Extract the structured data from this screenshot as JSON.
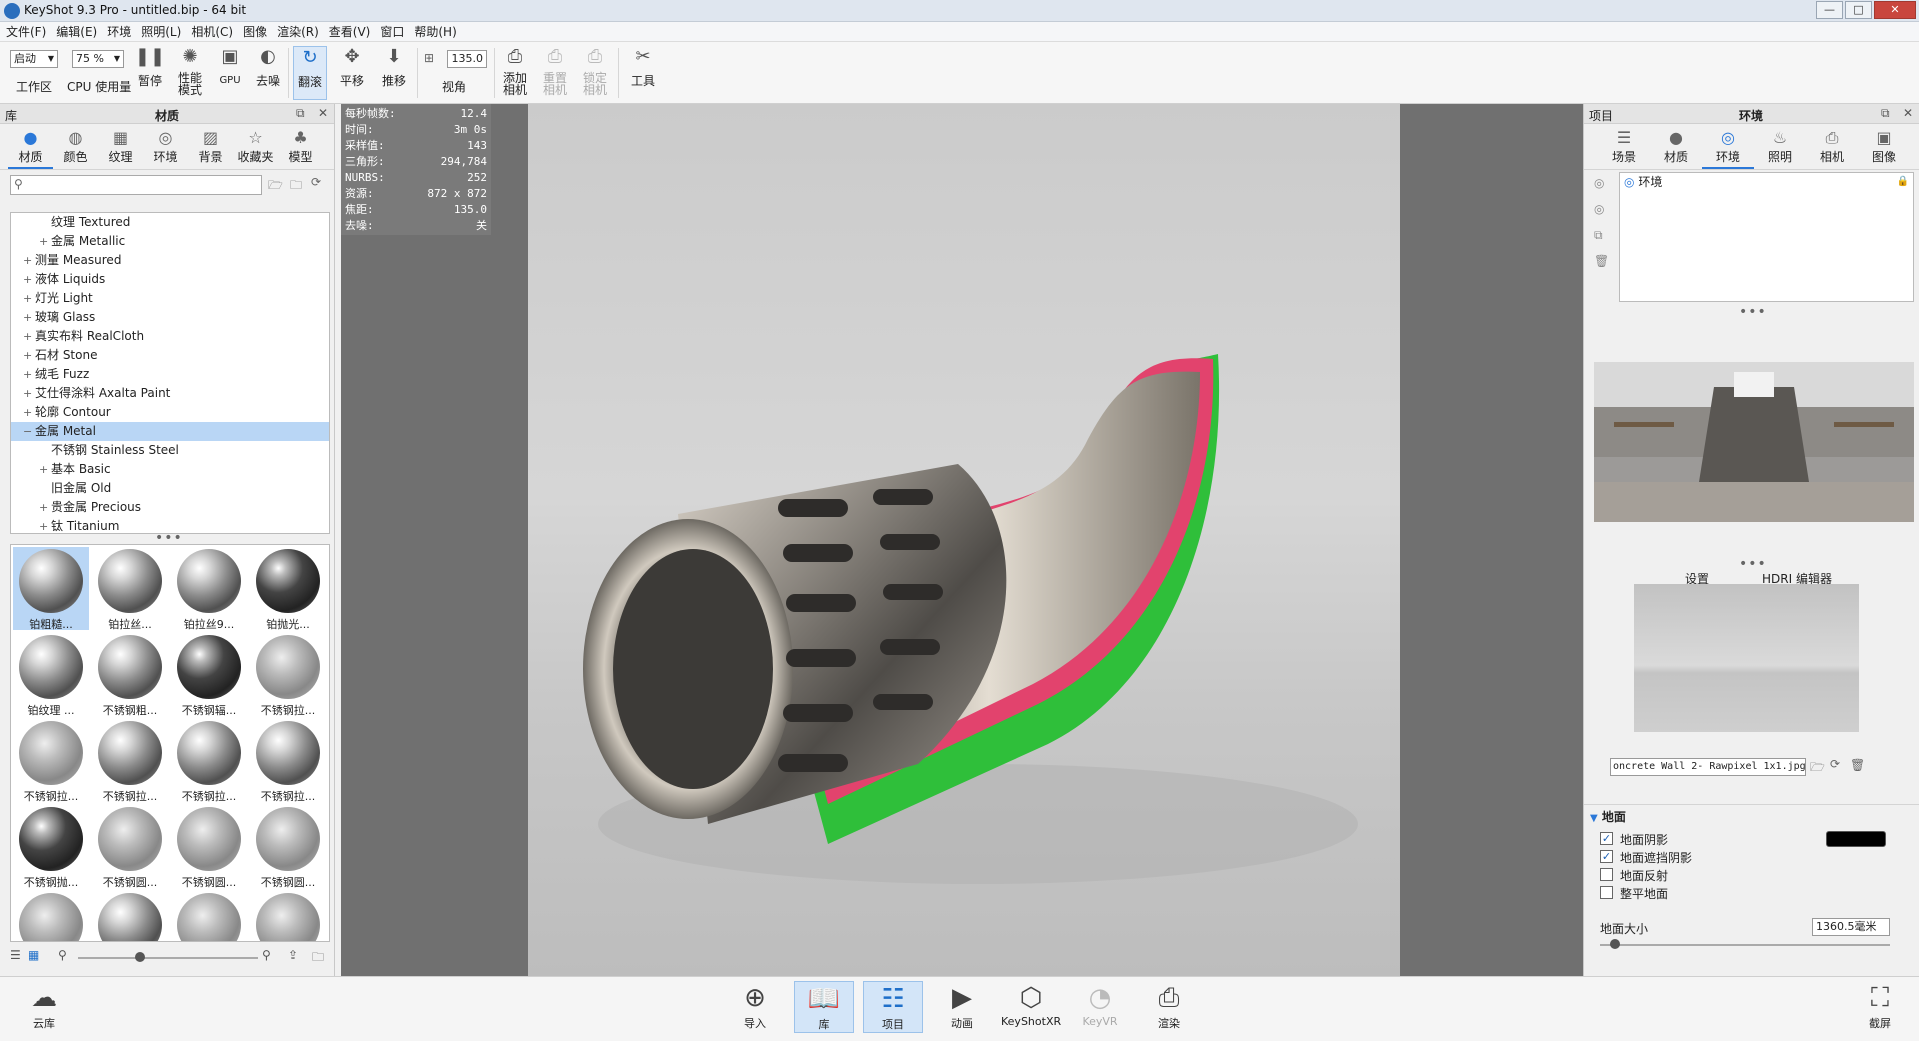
{
  "window": {
    "title": "KeyShot 9.3 Pro  - untitled.bip  - 64 bit",
    "min": "—",
    "max": "□",
    "close": "✕"
  },
  "menu": [
    "文件(F)",
    "编辑(E)",
    "环境",
    "照明(L)",
    "相机(C)",
    "图像",
    "渲染(R)",
    "查看(V)",
    "窗口",
    "帮助(H)"
  ],
  "toolbar": {
    "workspace_value": "启动",
    "workspace_label": "工作区",
    "cpu_value": "75 %",
    "cpu_label": "CPU 使用量",
    "pause": "暂停",
    "perf_mode": "性能\n模式",
    "gpu": "GPU",
    "denoise": "去噪",
    "tumble": "翻滚",
    "pan": "平移",
    "dolly": "推移",
    "fov_value": "135.0",
    "fov_label": "视角",
    "add_camera": "添加\n相机",
    "reset_camera": "重置\n相机",
    "lock_camera": "锁定\n相机",
    "tools": "工具"
  },
  "left": {
    "header_left": "库",
    "header_title": "材质",
    "tabs": [
      "材质",
      "颜色",
      "纹理",
      "环境",
      "背景",
      "收藏夹",
      "模型"
    ],
    "tree": [
      {
        "label": "纹理 Textured",
        "indent": 2,
        "tog": ""
      },
      {
        "label": "金属 Metallic",
        "indent": 2,
        "tog": "+"
      },
      {
        "label": "测量 Measured",
        "indent": 1,
        "tog": "+"
      },
      {
        "label": "液体 Liquids",
        "indent": 1,
        "tog": "+"
      },
      {
        "label": "灯光 Light",
        "indent": 1,
        "tog": "+"
      },
      {
        "label": "玻璃 Glass",
        "indent": 1,
        "tog": "+"
      },
      {
        "label": "真实布料 RealCloth",
        "indent": 1,
        "tog": "+"
      },
      {
        "label": "石材 Stone",
        "indent": 1,
        "tog": "+"
      },
      {
        "label": "绒毛 Fuzz",
        "indent": 1,
        "tog": "+"
      },
      {
        "label": "艾仕得涂料 Axalta Paint",
        "indent": 1,
        "tog": "+"
      },
      {
        "label": "轮廓 Contour",
        "indent": 1,
        "tog": "+"
      },
      {
        "label": "金属 Metal",
        "indent": 1,
        "tog": "−",
        "sel": true
      },
      {
        "label": "不锈钢 Stainless Steel",
        "indent": 2,
        "tog": ""
      },
      {
        "label": "基本 Basic",
        "indent": 2,
        "tog": "+"
      },
      {
        "label": "旧金属 Old",
        "indent": 2,
        "tog": ""
      },
      {
        "label": "贵金属 Precious",
        "indent": 2,
        "tog": "+"
      },
      {
        "label": "钛 Titanium",
        "indent": 2,
        "tog": "+"
      }
    ],
    "thumbs": [
      {
        "label": "铂粗糙...",
        "style": "",
        "sel": true
      },
      {
        "label": "铂拉丝...",
        "style": ""
      },
      {
        "label": "铂拉丝9...",
        "style": ""
      },
      {
        "label": "铂抛光...",
        "style": "dark"
      },
      {
        "label": "铂纹理 ...",
        "style": ""
      },
      {
        "label": "不锈钢粗...",
        "style": ""
      },
      {
        "label": "不锈钢辐...",
        "style": "dark"
      },
      {
        "label": "不锈钢拉...",
        "style": "pat"
      },
      {
        "label": "不锈钢拉...",
        "style": "pat"
      },
      {
        "label": "不锈钢拉...",
        "style": ""
      },
      {
        "label": "不锈钢拉...",
        "style": ""
      },
      {
        "label": "不锈钢拉...",
        "style": ""
      },
      {
        "label": "不锈钢抛...",
        "style": "dark"
      },
      {
        "label": "不锈钢圆...",
        "style": "pat"
      },
      {
        "label": "不锈钢圆...",
        "style": "pat"
      },
      {
        "label": "不锈钢圆...",
        "style": "pat"
      },
      {
        "label": "",
        "style": "pat"
      },
      {
        "label": "",
        "style": ""
      },
      {
        "label": "",
        "style": "pat"
      },
      {
        "label": "",
        "style": "pat"
      }
    ]
  },
  "stats": [
    {
      "k": "每秒帧数:",
      "v": "12.4"
    },
    {
      "k": "时间:",
      "v": "3m 0s"
    },
    {
      "k": "采样值:",
      "v": "143"
    },
    {
      "k": "三角形:",
      "v": "294,784"
    },
    {
      "k": "NURBS:",
      "v": "252"
    },
    {
      "k": "资源:",
      "v": "872 x 872"
    },
    {
      "k": "焦距:",
      "v": "135.0"
    },
    {
      "k": "去噪:",
      "v": "关"
    }
  ],
  "right": {
    "header_left": "项目",
    "header_title": "环境",
    "tabs": [
      "场景",
      "材质",
      "环境",
      "照明",
      "相机",
      "图像"
    ],
    "env_item": "环境",
    "subtabs": [
      "设置",
      "HDRI 编辑器"
    ],
    "env_file": "oncrete Wall 2- Rawpixel 1x1.jpg",
    "ground_section": "地面",
    "ground_options": [
      {
        "label": "地面阴影",
        "checked": true
      },
      {
        "label": "地面遮挡阴影",
        "checked": true
      },
      {
        "label": "地面反射",
        "checked": false
      },
      {
        "label": "整平地面",
        "checked": false
      }
    ],
    "ground_size_label": "地面大小",
    "ground_size_value": "1360.5毫米"
  },
  "bottom": {
    "cloud": "云库",
    "buttons": [
      {
        "label": "导入",
        "icon": "import-icon"
      },
      {
        "label": "库",
        "icon": "library-icon",
        "active": true
      },
      {
        "label": "项目",
        "icon": "project-icon",
        "active": true
      },
      {
        "label": "动画",
        "icon": "animation-icon"
      },
      {
        "label": "KeyShotXR",
        "icon": "keyshotxr-icon"
      },
      {
        "label": "KeyVR",
        "icon": "keyvr-icon",
        "dim": true
      },
      {
        "label": "渲染",
        "icon": "render-icon"
      }
    ],
    "screenshot": "截屏"
  }
}
